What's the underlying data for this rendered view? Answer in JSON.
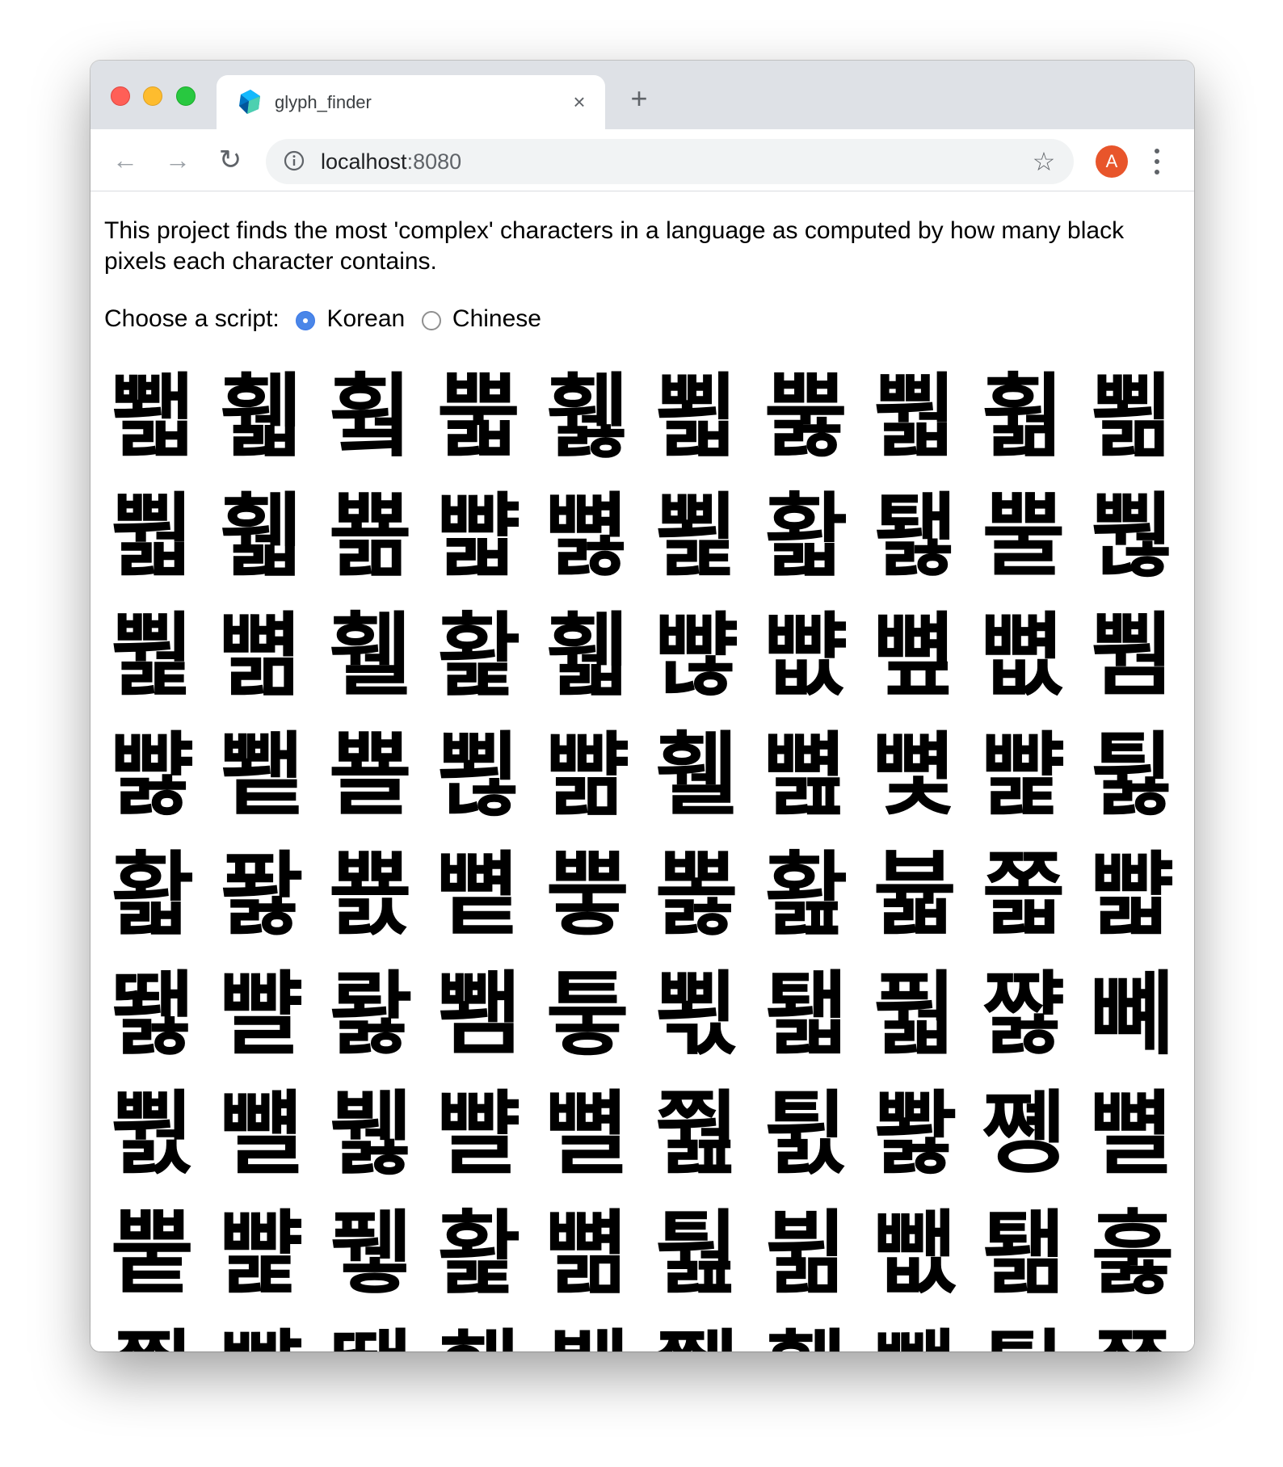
{
  "browser": {
    "tab_title": "glyph_finder",
    "tab_close": "×",
    "new_tab": "+",
    "url_host": "localhost",
    "url_port": ":8080",
    "avatar_letter": "A"
  },
  "page": {
    "description": "This project finds the most 'complex' characters in a language as computed by how many black pixels each character contains.",
    "choose_label": "Choose a script:",
    "options": [
      {
        "label": "Korean",
        "checked": true
      },
      {
        "label": "Chinese",
        "checked": false
      }
    ],
    "glyphs": [
      "뾃",
      "휇",
      "훸",
      "뿗",
      "휋",
      "뾟",
      "뿛",
      "뿳",
      "훪",
      "뾞",
      "뿳",
      "휇",
      "뾺",
      "뺣",
      "뼗",
      "뾡",
      "홟",
      "퇧",
      "뿔",
      "뿮",
      "뿵",
      "뼒",
      "휄",
      "홡",
      "휇",
      "뺞",
      "뺪",
      "뼢",
      "뼚",
      "뿸",
      "뺧",
      "뾑",
      "뾸",
      "뾚",
      "뺢",
      "휄",
      "뼖",
      "뼟",
      "뺥",
      "튏",
      "홟",
      "퐗",
      "뾼",
      "뼡",
      "뿧",
      "뽏",
      "홢",
      "뷻",
      "쫇",
      "뺣",
      "뙗",
      "뺠",
      "뢇",
      "뾈",
      "퉇",
      "뾗",
      "퇣",
      "풟",
      "쨣",
      "뼤",
      "뿴",
      "뺼",
      "뷇",
      "뺠",
      "뼐",
      "쭲",
      "튌",
      "뽫",
      "쪵",
      "뼐",
      "뿥",
      "뺥",
      "퓋",
      "홡",
      "뼒",
      "퉖",
      "뷞",
      "뺎",
      "퇢",
      "훓",
      "쬞",
      "뺥",
      "뙐",
      "홷",
      "뷁",
      "쮋",
      "휅",
      "뺕",
      "퉓",
      "쭖"
    ]
  }
}
